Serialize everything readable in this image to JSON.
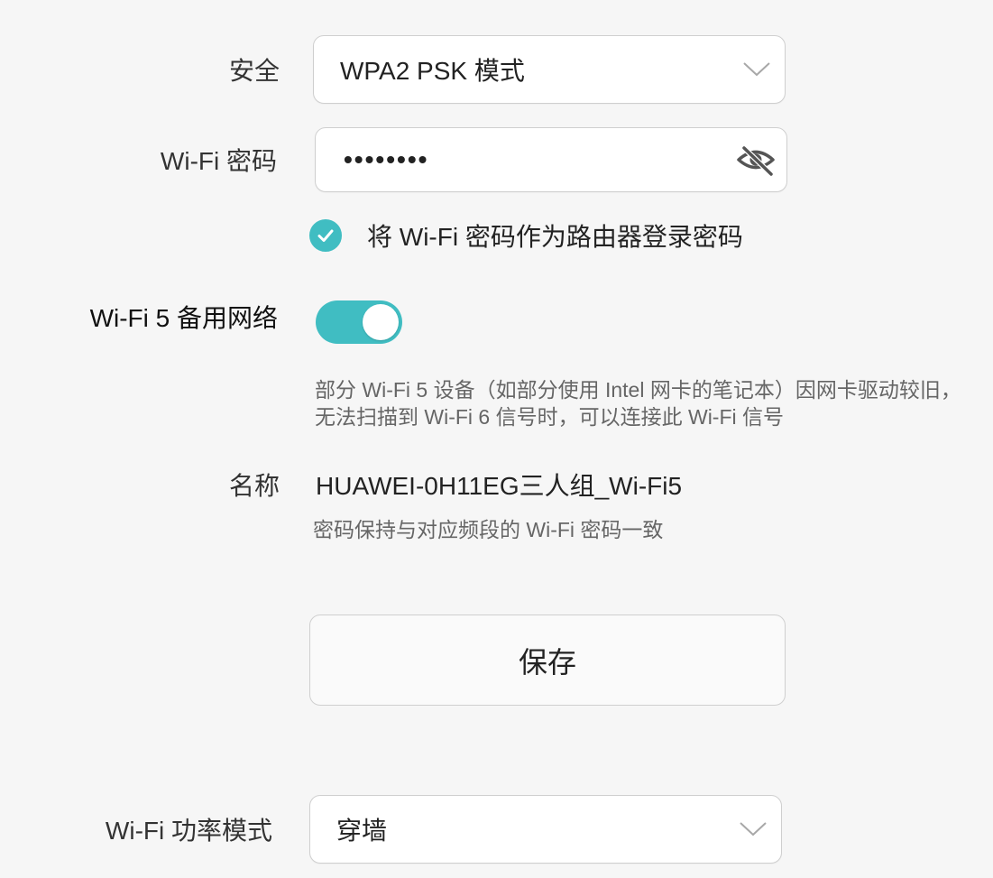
{
  "security": {
    "label": "安全",
    "value": "WPA2 PSK 模式",
    "icon": "chevron-down-icon"
  },
  "wifi_password": {
    "label": "Wi-Fi 密码",
    "value": "••••••••",
    "icon": "eye-off-icon"
  },
  "use_as_login": {
    "checked": true,
    "label": "将 Wi-Fi 密码作为路由器登录密码"
  },
  "wifi5_backup": {
    "label": "Wi-Fi 5 备用网络",
    "enabled": true,
    "description": "部分 Wi-Fi 5 设备（如部分使用 Intel 网卡的笔记本）因网卡驱动较旧，无法扫描到 Wi-Fi 6 信号时，可以连接此 Wi-Fi 信号"
  },
  "name": {
    "label": "名称",
    "value": "HUAWEI-0H11EG三人组_Wi-Fi5",
    "hint": "密码保持与对应频段的 Wi-Fi 密码一致"
  },
  "save_button": {
    "label": "保存"
  },
  "power_mode": {
    "label": "Wi-Fi 功率模式",
    "value": "穿墙",
    "icon": "chevron-down-icon"
  },
  "colors": {
    "accent": "#40bdc2",
    "background": "#f6f6f6",
    "field_border": "#cfcfcf",
    "secondary_text": "#666666"
  }
}
